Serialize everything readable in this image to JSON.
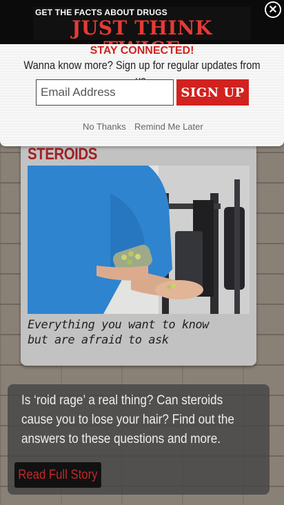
{
  "banner": {
    "tagline": "GET THE FACTS ABOUT DRUGS",
    "headline": "JUST THINK TWICE",
    "close_icon": "close-circle-icon"
  },
  "signup_popup": {
    "heading": "STAY CONNECTED!",
    "subheading": "Wanna know more? Sign up for regular updates from us.",
    "email_placeholder": "Email Address",
    "submit_label": "SIGN UP",
    "no_thanks_label": "No Thanks",
    "remind_label": "Remind Me Later"
  },
  "card": {
    "title": "STEROIDS",
    "image": "man-holding-pills-photo",
    "caption": "Everything you want to know but are afraid to ask"
  },
  "overlay": {
    "text": "Is ‘roid rage’ a real thing? Can steroids cause you to lose your hair? Find out the answers to these questions and more.",
    "link_label": "Read Full Story"
  },
  "colors": {
    "brand_red": "#d1221f",
    "title_red": "#a21f24",
    "banner_bg": "#0b0b0b"
  }
}
